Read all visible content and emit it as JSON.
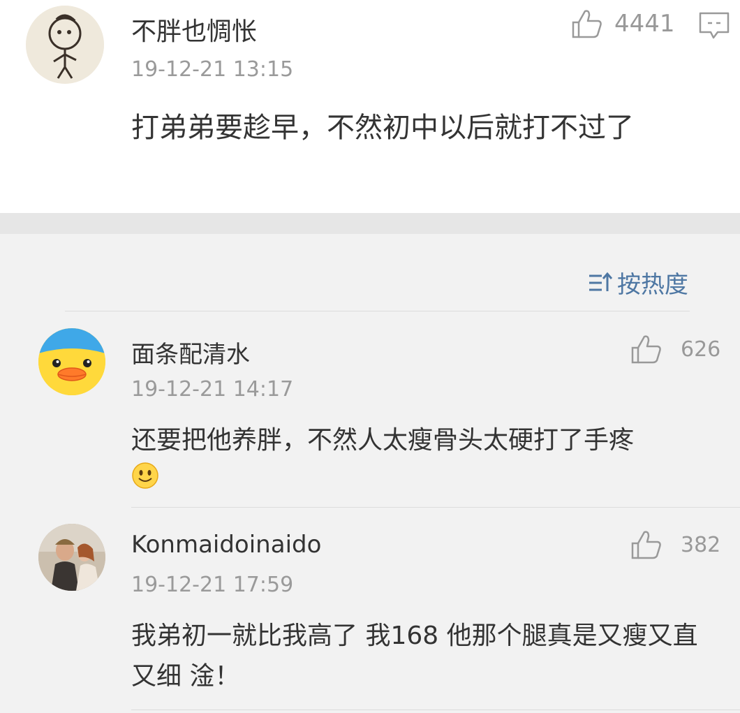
{
  "top_comment": {
    "username": "不胖也惆怅",
    "timestamp": "19-12-21 13:15",
    "likes": "4441",
    "text": "打弟弟要趁早，不然初中以后就打不过了"
  },
  "sort": {
    "label": "按热度"
  },
  "replies": [
    {
      "username": "面条配清水",
      "timestamp": "19-12-21 14:17",
      "likes": "626",
      "text": "还要把他养胖，不然人太瘦骨头太硬打了手疼",
      "emoji": "smile-emoji"
    },
    {
      "username": "Konmaidoinaido",
      "timestamp": "19-12-21 17:59",
      "likes": "382",
      "text": "我弟初一就比我高了 我168 他那个腿真是又瘦又直又细 淦！"
    }
  ],
  "colors": {
    "accent": "#4e77a3",
    "background": "#f2f2f2",
    "card": "#ffffff"
  }
}
